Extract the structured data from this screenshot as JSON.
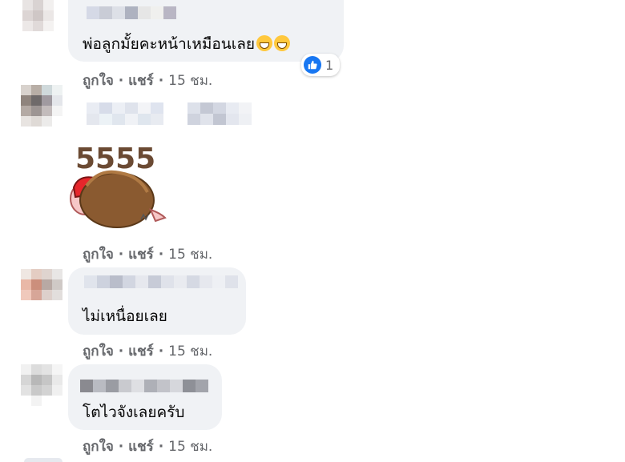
{
  "colors": {
    "bubble": "#f0f2f5",
    "meta_text": "#65676b",
    "like_blue": "#1877f2"
  },
  "comments": [
    {
      "text": "พ่อลูกมั้ยคะหน้าเหมือนเลย",
      "emoji": [
        "grinning-sweat-emoji",
        "grinning-sweat-emoji"
      ],
      "reaction": {
        "icon": "like-icon",
        "count": "1"
      },
      "actions": {
        "like": "ถูกใจ",
        "reply": "แชร์",
        "time": "15 ชม."
      }
    },
    {
      "sticker": {
        "text": "5555",
        "icon": "laughing-character-sticker"
      },
      "actions": {
        "like": "ถูกใจ",
        "reply": "แชร์",
        "time": "15 ชม."
      }
    },
    {
      "text": "ไม่เหนื่อยเลย",
      "actions": {
        "like": "ถูกใจ",
        "reply": "แชร์",
        "time": "15 ชม."
      }
    },
    {
      "text": "โตไวจังเลยครับ",
      "actions": {
        "like": "ถูกใจ",
        "reply": "แชร์",
        "time": "15 ชม."
      }
    }
  ],
  "separator": "·"
}
